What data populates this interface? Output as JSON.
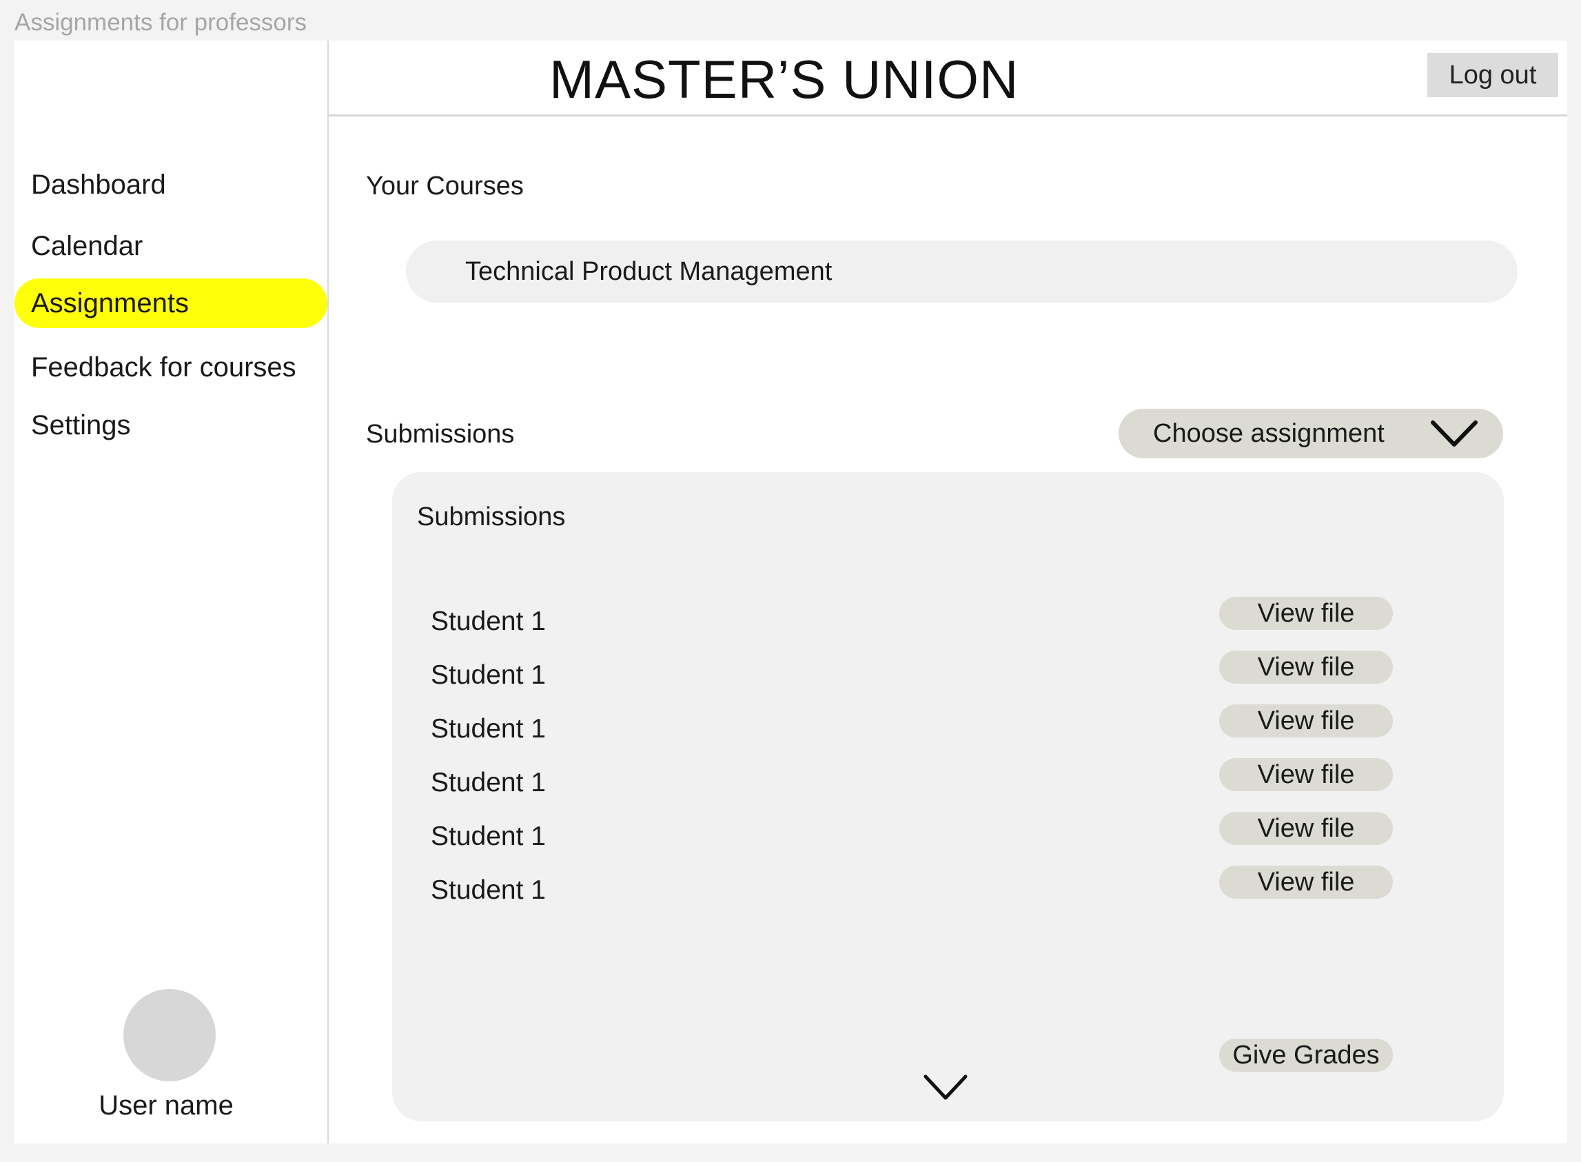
{
  "frame": {
    "title": "Assignments for professors"
  },
  "colors": {
    "active_nav": "#ffff0a",
    "button_bg": "#dbdbd3",
    "panel_bg": "#f1f1f1",
    "avatar": "#d7d7d7"
  },
  "sidebar": {
    "items": [
      {
        "label": "Dashboard",
        "active": false
      },
      {
        "label": "Calendar",
        "active": false
      },
      {
        "label": "Assignments",
        "active": true
      },
      {
        "label": "Feedback for courses",
        "active": false
      },
      {
        "label": "Settings",
        "active": false
      }
    ],
    "user_name": "User name"
  },
  "header": {
    "brand": "MASTER’S UNION",
    "logout_label": "Log out"
  },
  "courses": {
    "label": "Your Courses",
    "items": [
      "Technical Product Management"
    ]
  },
  "submissions": {
    "label": "Submissions",
    "choose_label": "Choose assignment",
    "choose_icon": "chevron-down-icon",
    "panel_title": "Submissions",
    "rows": [
      {
        "student": "Student 1",
        "action": "View file"
      },
      {
        "student": "Student 1",
        "action": "View file"
      },
      {
        "student": "Student 1",
        "action": "View file"
      },
      {
        "student": "Student 1",
        "action": "View file"
      },
      {
        "student": "Student 1",
        "action": "View file"
      },
      {
        "student": "Student 1",
        "action": "View file"
      }
    ],
    "grades_label": "Give Grades",
    "more_icon": "chevron-down-icon"
  }
}
